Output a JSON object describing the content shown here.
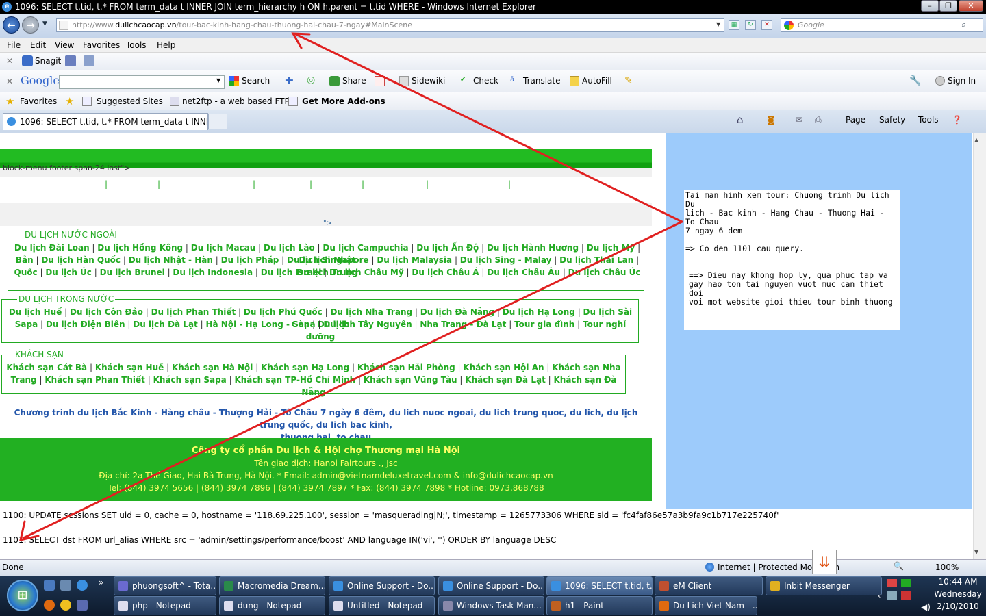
{
  "window": {
    "title": "1096: SELECT t.tid, t.* FROM term_data t INNER JOIN term_hierarchy h ON h.parent = t.tid WHERE  - Windows Internet Explorer"
  },
  "address": {
    "prefix": "http://www.",
    "domain": "dulichcaocap.vn",
    "path": "/tour-bac-kinh-hang-chau-thuong-hai-chau-7-ngay#MainScene"
  },
  "search": {
    "placeholder": "Google"
  },
  "menu": [
    "File",
    "Edit",
    "View",
    "Favorites",
    "Tools",
    "Help"
  ],
  "snagit": {
    "label": "Snagit"
  },
  "google_toolbar": {
    "logo": "Google",
    "search": "Search",
    "share": "Share",
    "sidewiki": "Sidewiki",
    "check": "Check",
    "translate": "Translate",
    "autofill": "AutoFill",
    "signin": "Sign In"
  },
  "favorites_bar": {
    "favorites": "Favorites",
    "suggested": "Suggested Sites",
    "net2ftp": "net2ftp - a web based FTP...",
    "addons": "Get More Add-ons"
  },
  "tab": {
    "title": "1096: SELECT t.tid, t.* FROM term_data t INNER J..."
  },
  "command_bar": {
    "page": "Page",
    "safety": "Safety",
    "tools": "Tools"
  },
  "page": {
    "block_text": "block-menu footer span-24 last\">",
    "arrow_mark": "\">",
    "overseas": {
      "legend": "DU LỊCH NƯỚC NGOÀI",
      "row1": [
        "Du lịch Đài Loan",
        "Du lịch Hồng Kông",
        "Du lịch Macau",
        "Du lịch Lào",
        "Du lịch Campuchia",
        "Du lịch Ấn Độ",
        "Du lịch Hành Hương",
        "Du lịch Mỹ",
        "Du lịch Nhật"
      ],
      "row2": [
        "Bản",
        "Du lịch Hàn Quốc",
        "Du lịch Nhật - Hàn",
        "Du lịch Pháp",
        "Du lịch Singapore",
        "Du lịch Malaysia",
        "Du lịch Sing - Malay",
        "Du lịch Thái Lan",
        "Du lịch Trung"
      ],
      "row3": [
        "Quốc",
        "Du lịch Úc",
        "Du lịch Brunei",
        "Du lịch Indonesia",
        "Du lịch Israel",
        "Du lịch Châu Mỹ",
        "Du lịch Châu Á",
        "Du lịch Châu Âu",
        "Du lịch Châu Úc"
      ]
    },
    "domestic": {
      "legend": "DU LỊCH TRONG NƯỚC",
      "row1": [
        "Du lịch Huế",
        "Du lịch Côn Đảo",
        "Du lịch Phan Thiết",
        "Du lịch Phú Quốc",
        "Du lịch Nha Trang",
        "Du lịch Đà Nẵng",
        "Du lịch Hạ Long",
        "Du lịch Sài Gòn",
        "Du lịch"
      ],
      "row2": [
        "Sapa",
        "Du lịch Điện Biên",
        "Du lịch Đà Lạt",
        "Hà Nội - Hạ Long - Sapa",
        "Du lịch Tây Nguyên",
        "Nha Trang - Đà Lạt",
        "Tour gia đình",
        "Tour nghỉ dưỡng"
      ]
    },
    "hotels": {
      "legend": "KHÁCH SẠN",
      "row1": [
        "Khách sạn Cát Bà",
        "Khách sạn Huế",
        "Khách sạn Hà Nội",
        "Khách sạn Hạ Long",
        "Khách sạn Hải Phòng",
        "Khách sạn Hội An",
        "Khách sạn Nha"
      ],
      "row2": [
        "Trang",
        "Khách sạn Phan Thiết",
        "Khách sạn Sapa",
        "Khách sạn TP-Hồ Chí Minh",
        "Khách sạn Vũng Tàu",
        "Khách sạn Đà Lạt",
        "Khách sạn Đà Nẵng"
      ]
    },
    "description_line1": "Chương trình du lịch Bắc Kinh - Hàng châu - Thượng Hải - Tô Châu 7 ngày 6 đêm, du lich nuoc ngoai, du lich trung quoc, du lich, du lịch trung quốc, du lich bac kinh,",
    "description_line2": "thuong hai, to chau",
    "footer": {
      "company": "Công ty cổ phần Du lịch & Hội chợ Thương mại Hà Nội",
      "trade_name": "Tên giao dịch: Hanoi Fairtours ., Jsc",
      "address": "Địa chỉ: 2a Thể Giao, Hai Bà Trưng, Hà Nội. * Email: admin@vietnamdeluxetravel.com & info@dulichcaocap.vn",
      "phones": "Tel: (844) 3974 5656 | (844) 3974 7896 | (844) 3974 7897 * Fax: (844) 3974 7898 * Hotline: 0973.868788"
    },
    "query_1100": "1100: UPDATE sessions SET uid = 0, cache = 0, hostname = '118.69.225.100', session = 'masquerading|N;', timestamp = 1265773306 WHERE sid = 'fc4faf86e57a3b9fa9c1b717e225740f'",
    "query_1101": "1101: SELECT dst FROM url_alias WHERE src = 'admin/settings/performance/boost' AND language IN('vi', '') ORDER BY language DESC"
  },
  "note": {
    "line1": "Tai man hinh xem tour: Chuong trinh Du lich Du",
    "line2": "lich - Bac kinh - Hang Chau - Thuong Hai - To Chau",
    "line3": "7 ngay 6 dem",
    "line4": "=> Co den 1101 cau query.",
    "line5": "==> Dieu nay khong hop ly, qua phuc tap va",
    "line6": "gay hao ton tai nguyen vuot muc can thiet doi",
    "line7": "voi mot website gioi thieu tour binh thuong"
  },
  "status": {
    "done": "Done",
    "zone": "Internet | Protected Mode: On",
    "zoom": "100%"
  },
  "taskbar": {
    "row1": [
      "phuongsoft^ - Tota...",
      "Macromedia Dream...",
      "Online Support - Do...",
      "Online Support - Do...",
      "1096: SELECT t.tid, t...",
      "eM Client",
      "Inbit Messenger"
    ],
    "row2": [
      "php - Notepad",
      "dung - Notepad",
      "Untitled - Notepad",
      "Windows Task Man...",
      "h1 - Paint",
      "Du Lich Viet Nam - ..."
    ],
    "time": "10:44 AM",
    "day": "Wednesday",
    "date": "2/10/2010"
  },
  "colors": {
    "link_green": "#22aa22",
    "panel_blue": "#9dcbfb",
    "footer_green": "#22b022",
    "footer_text": "#ffff66",
    "arrow_red": "#e02020"
  }
}
